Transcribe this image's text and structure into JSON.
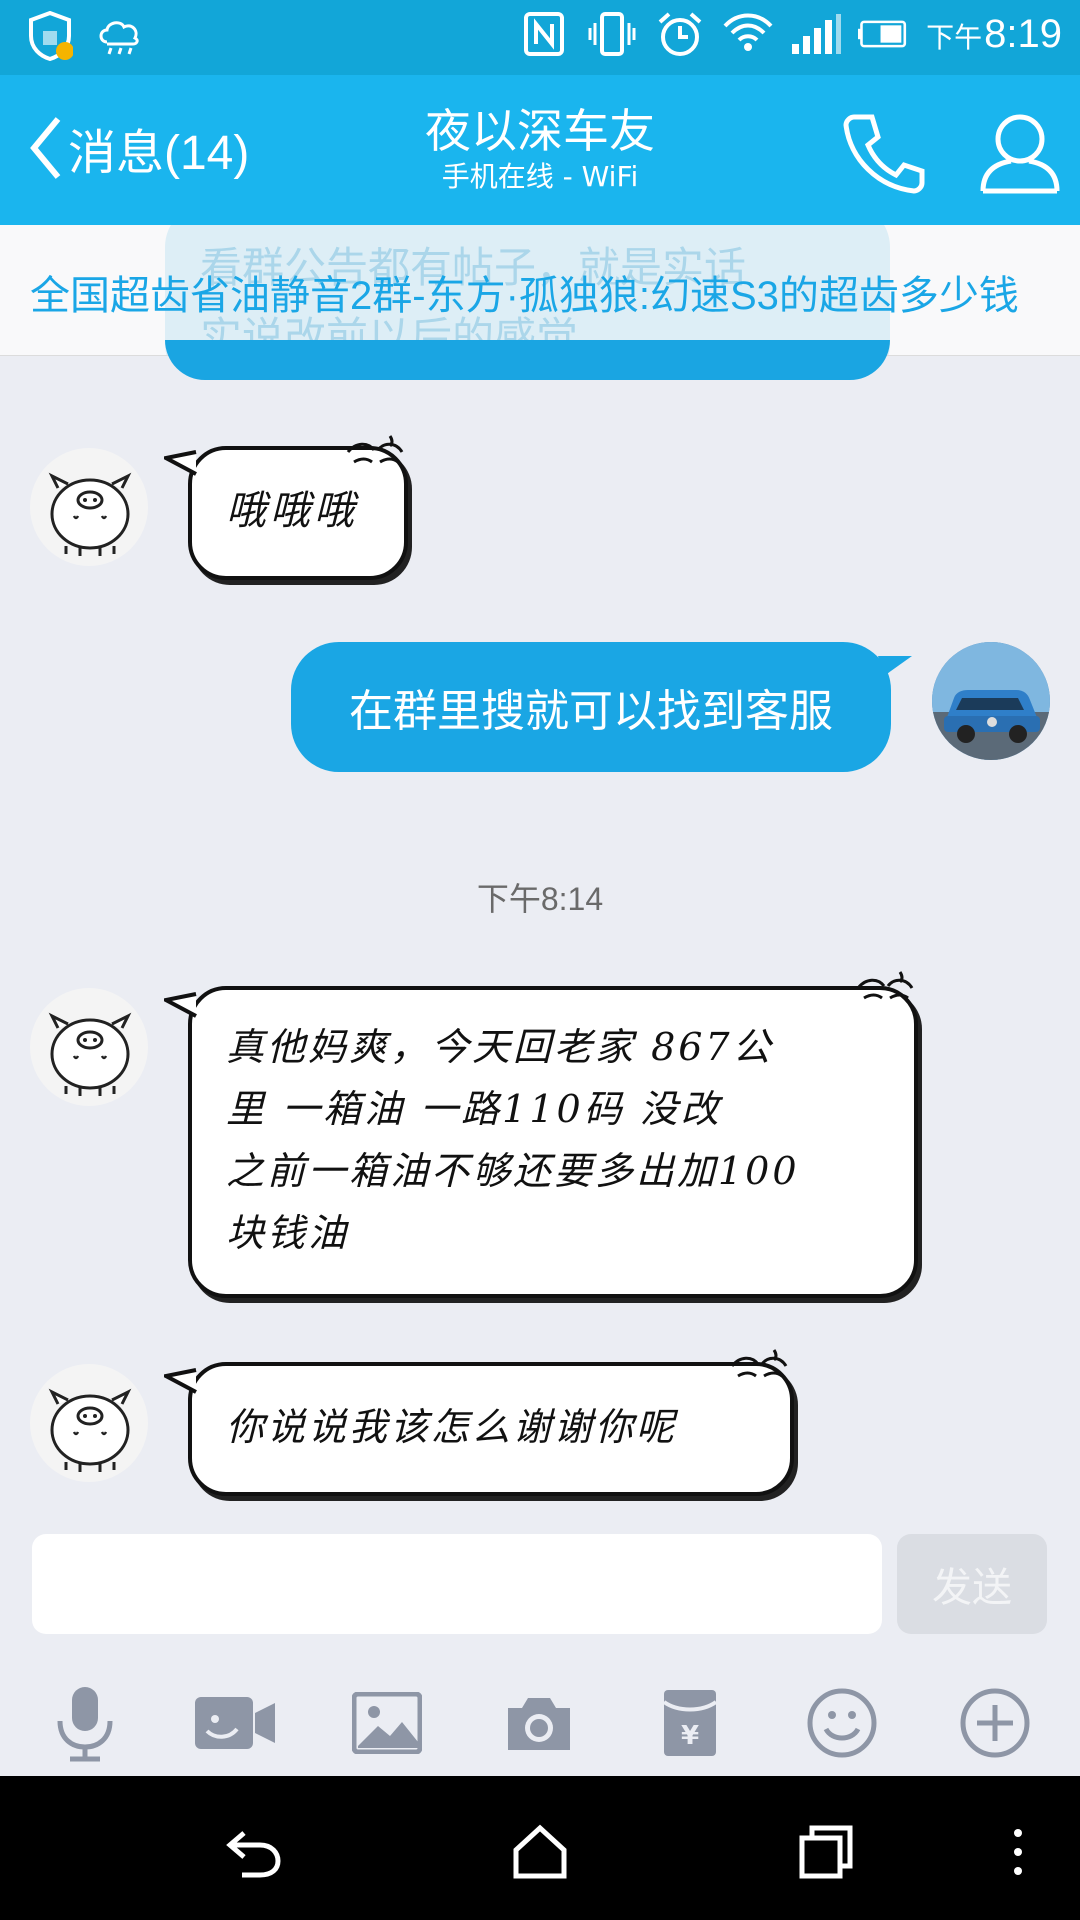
{
  "status_bar": {
    "time_prefix": "下午",
    "time": "8:19"
  },
  "header": {
    "back_label": "消息(14)",
    "title": "夜以深车友",
    "subtitle": "手机在线 - WiFi"
  },
  "notice": {
    "text": "全国超齿省油静音2群-东方·孤独狼:幻速S3的超齿多少钱",
    "ghost_text_1": "看群公告都有帖子，就是实话",
    "ghost_text_2": "实说改前以后的感觉"
  },
  "messages": [
    {
      "side": "left",
      "text": "哦哦哦"
    },
    {
      "side": "right",
      "text": "在群里搜就可以找到客服"
    },
    {
      "side": "left",
      "lines": [
        "真他妈爽，今天回老家  867公",
        "里  一箱油  一路110码  没改",
        "之前一箱油不够还要多出加100",
        "块钱油"
      ]
    },
    {
      "side": "left",
      "text": "你说说我该怎么谢谢你呢"
    }
  ],
  "timestamp": "下午8:14",
  "composer": {
    "placeholder": "",
    "value": "",
    "send_label": "发送"
  },
  "toolbar": {
    "items": [
      "microphone-icon",
      "video-icon",
      "image-icon",
      "camera-icon",
      "red-packet-icon",
      "emoji-icon",
      "plus-icon"
    ]
  },
  "colors": {
    "status_bar": "#12a6d8",
    "title_bar": "#1ab5ee",
    "bubble_blue": "#1aa6e4",
    "background": "#ebedf3"
  }
}
